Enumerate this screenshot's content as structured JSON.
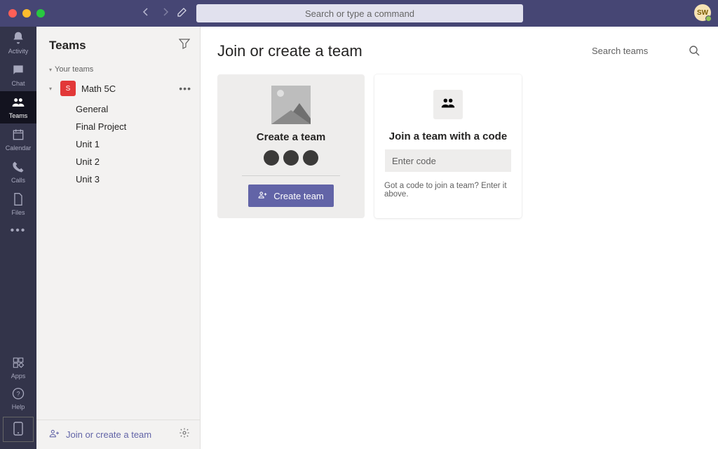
{
  "titlebar": {
    "search_placeholder": "Search or type a command",
    "avatar_initials": "SW"
  },
  "rail": {
    "items": [
      {
        "label": "Activity"
      },
      {
        "label": "Chat"
      },
      {
        "label": "Teams"
      },
      {
        "label": "Calendar"
      },
      {
        "label": "Calls"
      },
      {
        "label": "Files"
      }
    ],
    "bottom": [
      {
        "label": "Apps"
      },
      {
        "label": "Help"
      }
    ]
  },
  "sidebar": {
    "title": "Teams",
    "section_label": "Your teams",
    "team": {
      "initial": "S",
      "name": "Math 5C",
      "channels": [
        "General",
        "Final Project",
        "Unit 1",
        "Unit 2",
        "Unit 3"
      ]
    },
    "join_link": "Join or create a team"
  },
  "main": {
    "heading": "Join or create a team",
    "search_placeholder": "Search teams",
    "create_card": {
      "title": "Create a team",
      "button": "Create team"
    },
    "join_card": {
      "title": "Join a team with a code",
      "placeholder": "Enter code",
      "hint": "Got a code to join a team? Enter it above."
    }
  }
}
